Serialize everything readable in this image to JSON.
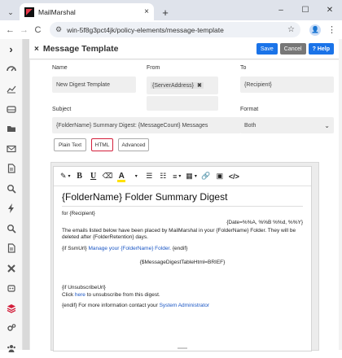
{
  "browser": {
    "tab_title": "MailMarshal",
    "url": "win-5f8g3pct4jk/policy-elements/message-template",
    "minimize": "–",
    "maximize": "☐",
    "close": "✕",
    "profile": "👤"
  },
  "panel": {
    "title": "Message Template",
    "save": "Save",
    "cancel": "Cancel",
    "help": "Help",
    "help_icon": "?",
    "close_glyph": "×",
    "collapse_glyph": "›"
  },
  "form": {
    "name_label": "Name",
    "name_value": "New Digest Template",
    "from_label": "From",
    "from_chip": "{ServerAddress}",
    "to_label": "To",
    "to_value": "{Recipient}",
    "subject_label": "Subject",
    "subject_value": "{FolderName} Summary Digest: {MessageCount} Messages",
    "format_label": "Format",
    "format_value": "Both",
    "tabs": [
      "Plain Text",
      "HTML",
      "Advanced"
    ]
  },
  "editor": {
    "heading": "{FolderName} Folder Summary Digest",
    "for_line": "for {Recipient}",
    "date_line": "{Date=%%A, %%B %%d, %%Y}",
    "body_text": "The emails listed below have been placed by MailMarshal in your {FolderName} Folder. They will be deleted after {FolderRetention} days.",
    "if_ssmurl": "{if SsmUrl}",
    "manage_link": "Manage your {FolderName} Folder.",
    "endif": "{endif}",
    "table_token": "{$MessageDigestTableHtml=BRIEF}",
    "if_unsub": "{if UnsubscribeUrl}",
    "click": "Click",
    "here_link": "here",
    "unsub_rest": "to unsubscribe from this digest.",
    "endif_contact": "{endif} For more information contact your",
    "sysadmin_link": "System Administrator"
  },
  "colors": {
    "accent_blue": "#1a73e8",
    "brand_red": "#d31f3b",
    "link": "#1a56c4"
  }
}
